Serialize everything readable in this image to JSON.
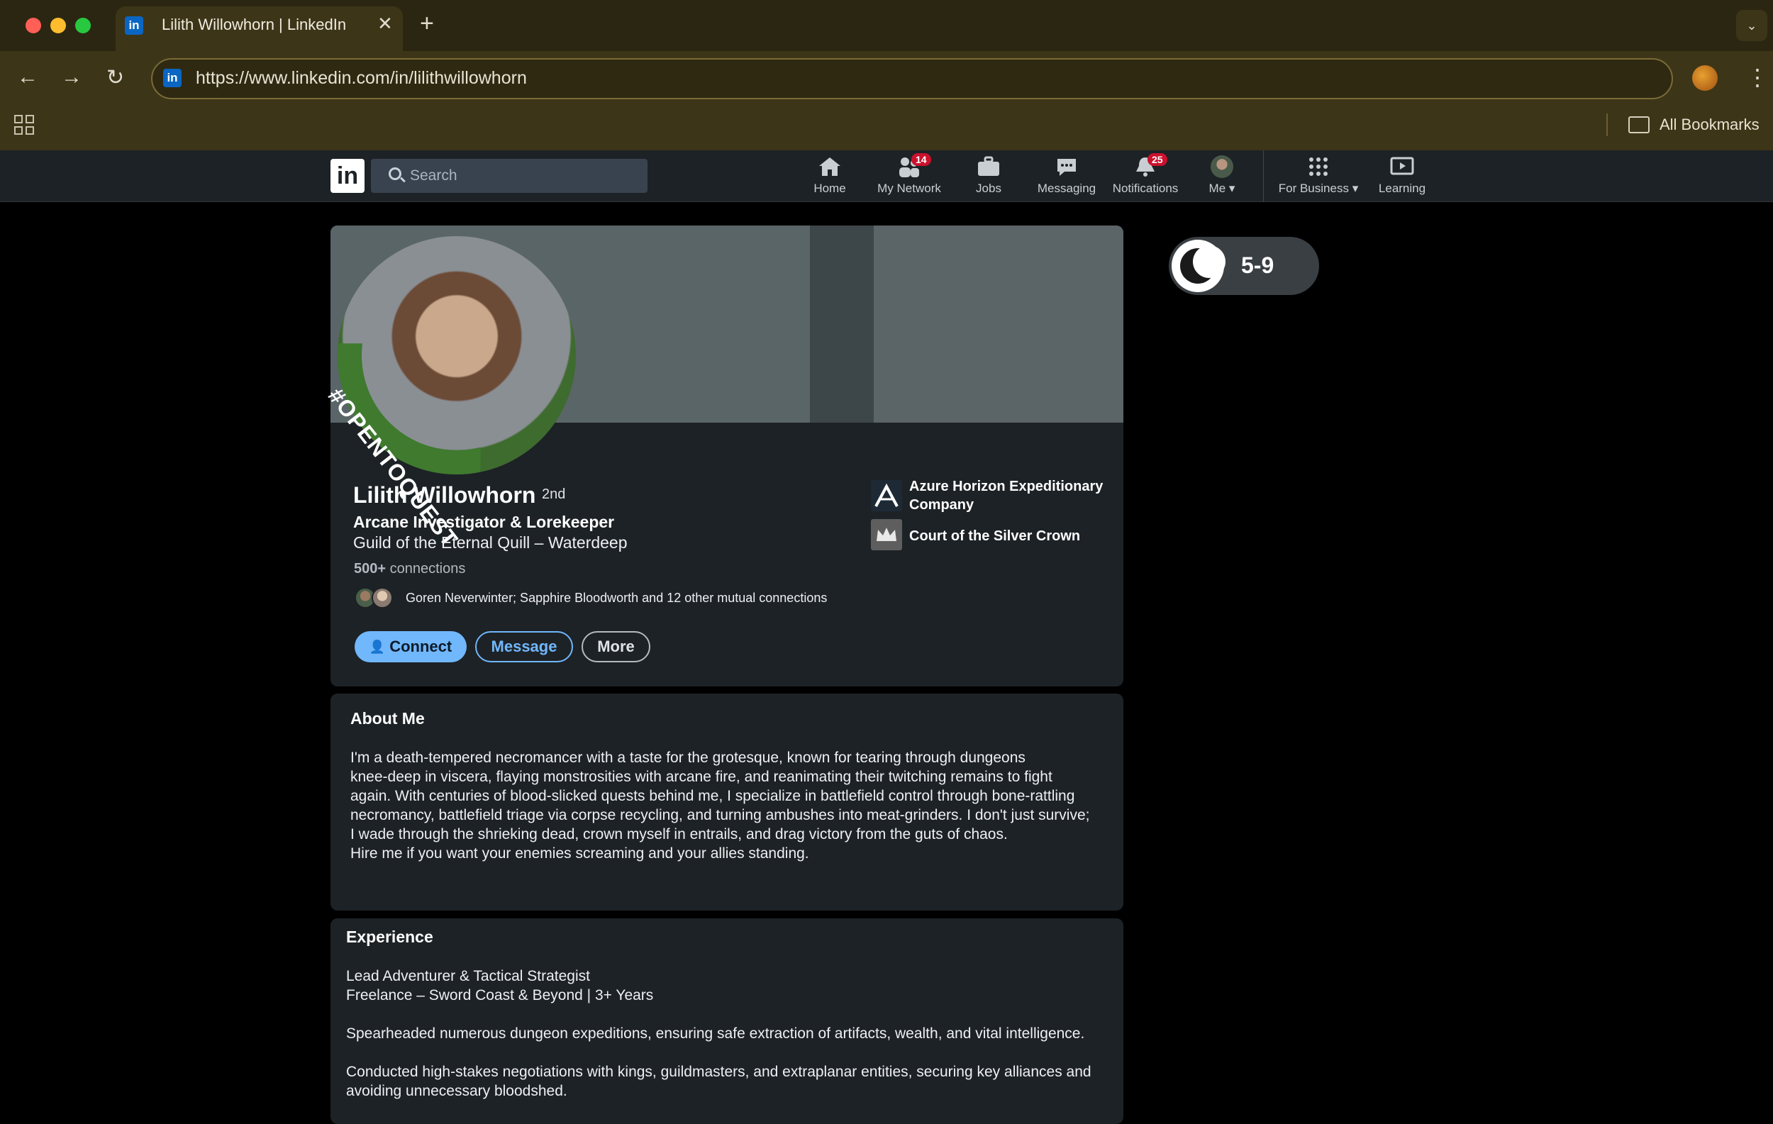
{
  "browser": {
    "tab_title": "Lilith Willowhorn  | LinkedIn",
    "favicon_text": "in",
    "url": "https://www.linkedin.com/in/lilithwillowhorn",
    "bookmarks_label": "All Bookmarks"
  },
  "linkedin_nav": {
    "logo": "in",
    "search_placeholder": "Search",
    "items": [
      {
        "label": "Home"
      },
      {
        "label": "My Network",
        "badge": "14"
      },
      {
        "label": "Jobs"
      },
      {
        "label": "Messaging"
      },
      {
        "label": "Notifications",
        "badge": "25"
      },
      {
        "label": "Me"
      },
      {
        "label": "For Business"
      },
      {
        "label": "Learning"
      }
    ]
  },
  "profile": {
    "photo_frame_text": "#OPENTOQUEST",
    "name": "Lilith Willowhorn",
    "degree": "2nd",
    "headline": "Arcane Investigator & Lorekeeper",
    "subline": "Guild of the Eternal Quill – Waterdeep",
    "connections_count": "500+",
    "connections_label": "connections",
    "mutual": "Goren Neverwinter; Sapphire Bloodworth  and 12 other mutual connections",
    "buttons": {
      "connect": "Connect",
      "message": "Message",
      "more": "More"
    },
    "orgs": [
      {
        "name": "Azure Horizon Expeditionary Company"
      },
      {
        "name": "Court of the Silver Crown"
      }
    ]
  },
  "toggle": {
    "label": "5-9"
  },
  "about": {
    "title": "About Me",
    "lines": [
      "I'm a death-tempered necromancer with a taste for the grotesque, known for tearing through dungeons",
      "knee-deep in viscera, flaying monstrosities with arcane fire, and reanimating their twitching remains to fight",
      "again. With centuries of blood-slicked quests behind me, I specialize in battlefield control through bone-rattling",
      "necromancy, battlefield triage via corpse recycling, and turning ambushes into meat-grinders. I don't just survive;",
      "I wade through the shrieking dead, crown myself in entrails, and drag victory from the guts of chaos.",
      "Hire me if you want your enemies screaming and your allies standing."
    ]
  },
  "experience": {
    "title": "Experience",
    "role": "Lead Adventurer & Tactical Strategist",
    "org": "Freelance – Sword Coast & Beyond | 3+ Years",
    "bullet1": "Spearheaded numerous dungeon expeditions, ensuring safe extraction of artifacts, wealth, and vital intelligence.",
    "bullet2_line1": "Conducted high-stakes negotiations with kings, guildmasters, and extraplanar entities, securing key alliances and",
    "bullet2_line2": "avoiding unnecessary bloodshed."
  },
  "colors": {
    "accent": "#71b7fb",
    "badge": "#cb112d",
    "open_ring": "#3f7a2f"
  }
}
